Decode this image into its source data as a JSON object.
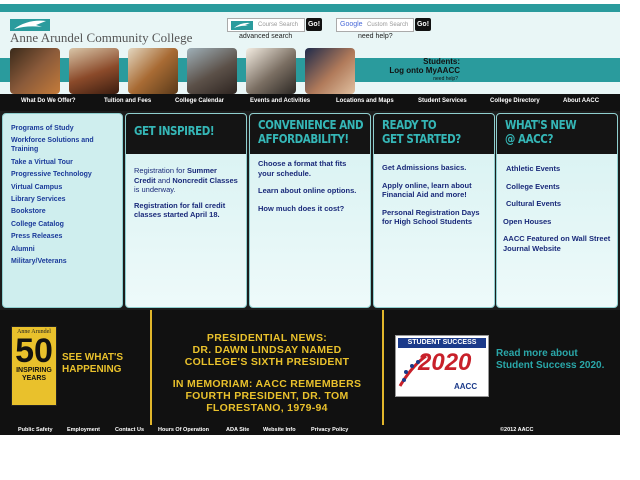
{
  "header": {
    "logo_text": "Anne Arundel Community College",
    "course_search_placeholder": "Course Search",
    "custom_search_placeholder": "Custom Search",
    "google_label": "Google",
    "go_label": "Go!",
    "advanced_search": "advanced search",
    "need_help": "need help?"
  },
  "students": {
    "line1": "Students:",
    "line2": "Log onto MyAACC",
    "need_help": "need help?"
  },
  "nav": [
    "What Do We Offer?",
    "Tuition and Fees",
    "College Calendar",
    "Events and Activities",
    "Locations and Maps",
    "Student Services",
    "College Directory",
    "About AACC"
  ],
  "sidebar": [
    "Programs of Study",
    "Workforce Solutions and Training",
    "Take a Virtual Tour",
    "Progressive Technology",
    "Virtual Campus",
    "Library Services",
    "Bookstore",
    "College Catalog",
    "Press Releases",
    "Alumni",
    "Military/Veterans"
  ],
  "panels": {
    "inspired": {
      "title": "GET INSPIRED!",
      "p1_a": "Registration for ",
      "p1_b": "Summer Credit",
      "p1_c": " and ",
      "p1_d": "Noncredit Classes",
      "p1_e": " is underway.",
      "p2": "Registration for fall credit classes started April 18."
    },
    "convenience": {
      "title_1": "CONVENIENCE AND",
      "title_2": "AFFORDABILITY!",
      "items": [
        "Choose a format that fits your schedule.",
        "Learn about online options.",
        "How much does it cost?"
      ]
    },
    "ready": {
      "title_1": "READY TO",
      "title_2": "GET STARTED?",
      "items": [
        "Get Admissions basics.",
        "Apply online, learn about Financial Aid and more!",
        "Personal Registration Days for High School Students"
      ]
    },
    "whatsnew": {
      "title_1": "WHAT'S NEW",
      "title_2": "@ AACC?",
      "items": [
        "Athletic Events",
        "College Events",
        "Cultural Events",
        "Open Houses",
        "AACC Featured on Wall Street Journal Website"
      ]
    }
  },
  "lower": {
    "badge_top": "Anne Arundel",
    "badge_num": "50",
    "badge_line1": "INSPIRING",
    "badge_line2": "YEARS",
    "see_what_1": "SEE WHAT'S",
    "see_what_2": "HAPPENING",
    "news_1a": "PRESIDENTIAL NEWS:",
    "news_1b": "DR. DAWN LINDSAY NAMED",
    "news_1c": "COLLEGE'S SIXTH PRESIDENT",
    "news_2a": "IN MEMORIAM: AACC REMEMBERS",
    "news_2b": "FOURTH PRESIDENT, DR. TOM",
    "news_2c": "FLORESTANO, 1979-94",
    "ss_img_top": "STUDENT SUCCESS",
    "ss_img_year": "2020",
    "ss_img_brand": "AACC",
    "ss_text": "Read more about Student Success 2020."
  },
  "footer": {
    "links": [
      "Public Safety",
      "Employment",
      "Contact Us",
      "Hours Of Operation",
      "ADA Site",
      "Website Info",
      "Privacy Policy"
    ],
    "copyright": "©2012 AACC"
  },
  "colors": {
    "teal": "#2a9b9d",
    "gold": "#e9c12c",
    "navy": "#1a2a7a",
    "dark": "#111111"
  }
}
